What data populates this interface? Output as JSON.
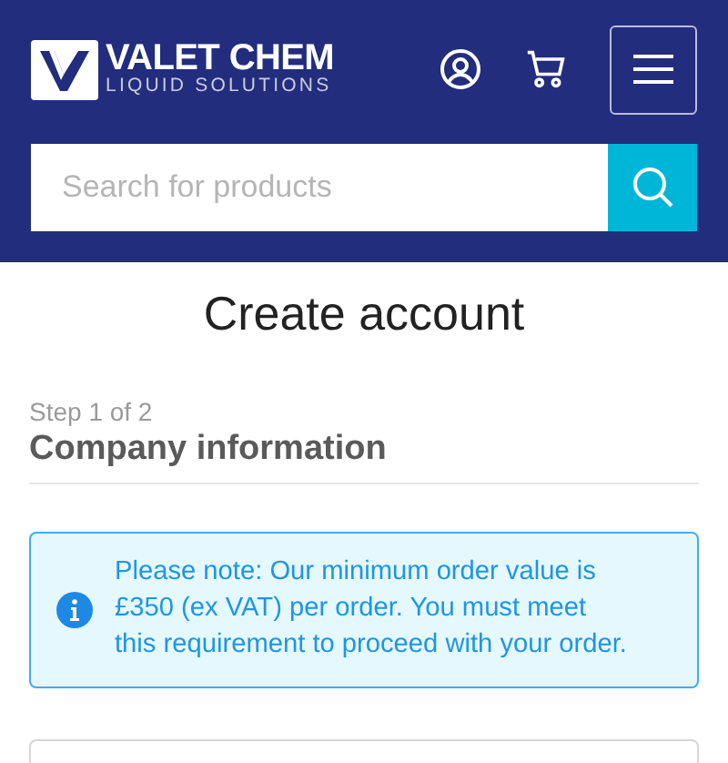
{
  "header": {
    "logo": {
      "name": "VALET CHEM",
      "tagline": "LIQUID SOLUTIONS"
    }
  },
  "search": {
    "placeholder": "Search for products"
  },
  "page_title": "Create account",
  "step": {
    "label": "Step 1 of 2",
    "title": "Company information"
  },
  "notice": {
    "text": "Please note: Our minimum order value is £350 (ex VAT) per order. You must meet this requirement to proceed with your order."
  }
}
